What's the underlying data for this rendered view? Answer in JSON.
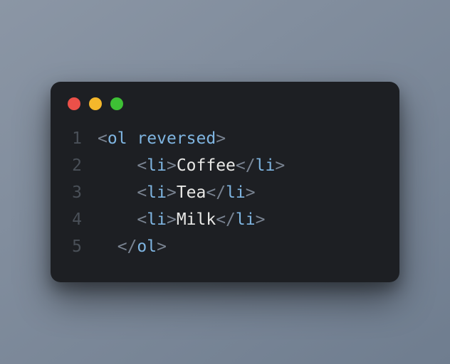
{
  "code": {
    "lines": [
      {
        "num": "1",
        "indent": "",
        "p1": "<",
        "tag": "ol",
        "space": " ",
        "attr": "reversed",
        "p2": ">",
        "text": "",
        "p3": "",
        "ctag": "",
        "p4": ""
      },
      {
        "num": "2",
        "indent": "    ",
        "p1": "<",
        "tag": "li",
        "space": "",
        "attr": "",
        "p2": ">",
        "text": "Coffee",
        "p3": "</",
        "ctag": "li",
        "p4": ">"
      },
      {
        "num": "3",
        "indent": "    ",
        "p1": "<",
        "tag": "li",
        "space": "",
        "attr": "",
        "p2": ">",
        "text": "Tea",
        "p3": "</",
        "ctag": "li",
        "p4": ">"
      },
      {
        "num": "4",
        "indent": "    ",
        "p1": "<",
        "tag": "li",
        "space": "",
        "attr": "",
        "p2": ">",
        "text": "Milk",
        "p3": "</",
        "ctag": "li",
        "p4": ">"
      },
      {
        "num": "5",
        "indent": "  ",
        "p1": "</",
        "tag": "ol",
        "space": "",
        "attr": "",
        "p2": ">",
        "text": "",
        "p3": "",
        "ctag": "",
        "p4": ""
      }
    ]
  }
}
